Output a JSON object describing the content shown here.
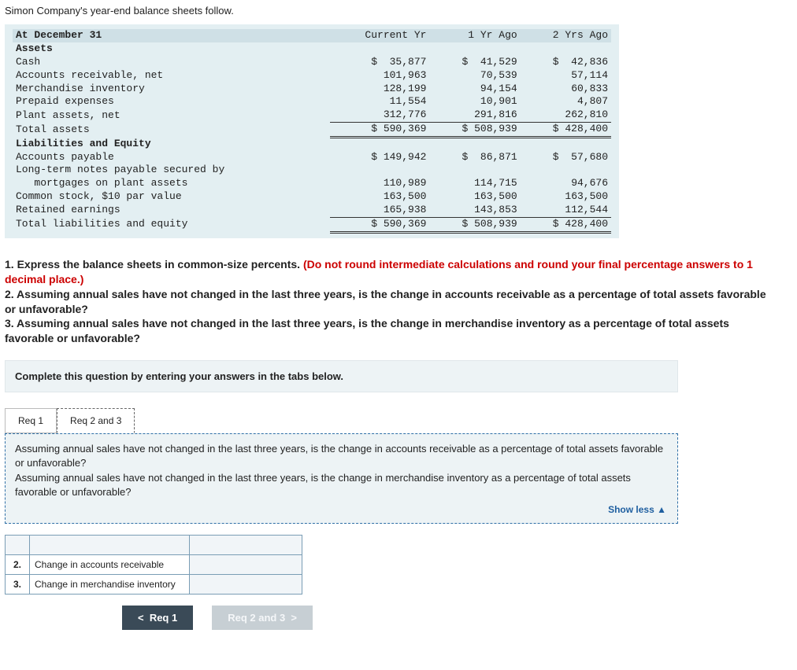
{
  "intro": "Simon Company's year-end balance sheets follow.",
  "bs": {
    "header": "At December 31",
    "cols": [
      "Current Yr",
      "1 Yr Ago",
      "2 Yrs Ago"
    ],
    "assets_hdr": "Assets",
    "rows_assets": [
      {
        "label": "Cash",
        "c": "$  35,877",
        "y1": "$  41,529",
        "y2": "$  42,836"
      },
      {
        "label": "Accounts receivable, net",
        "c": "101,963",
        "y1": "70,539",
        "y2": "57,114"
      },
      {
        "label": "Merchandise inventory",
        "c": "128,199",
        "y1": "94,154",
        "y2": "60,833"
      },
      {
        "label": "Prepaid expenses",
        "c": "11,554",
        "y1": "10,901",
        "y2": "4,807"
      },
      {
        "label": "Plant assets, net",
        "c": "312,776",
        "y1": "291,816",
        "y2": "262,810",
        "under": true
      }
    ],
    "total_assets": {
      "label": "Total assets",
      "c": "$ 590,369",
      "y1": "$ 508,939",
      "y2": "$ 428,400"
    },
    "liabeq_hdr": "Liabilities and Equity",
    "rows_liab": [
      {
        "label": "Accounts payable",
        "c": "$ 149,942",
        "y1": "$  86,871",
        "y2": "$  57,680"
      },
      {
        "label": "Long-term notes payable secured by",
        "c": "",
        "y1": "",
        "y2": ""
      },
      {
        "label": "   mortgages on plant assets",
        "c": "110,989",
        "y1": "114,715",
        "y2": "94,676"
      },
      {
        "label": "Common stock, $10 par value",
        "c": "163,500",
        "y1": "163,500",
        "y2": "163,500"
      },
      {
        "label": "Retained earnings",
        "c": "165,938",
        "y1": "143,853",
        "y2": "112,544",
        "under": true
      }
    ],
    "total_liab": {
      "label": "Total liabilities and equity",
      "c": "$ 590,369",
      "y1": "$ 508,939",
      "y2": "$ 428,400"
    }
  },
  "q": {
    "q1a": "1. Express the balance sheets in common-size percents. ",
    "q1b": "(Do not round intermediate calculations and round your final percentage answers to 1 decimal place.)",
    "q2": "2. Assuming annual sales have not changed in the last three years, is the change in accounts receivable as a percentage of total assets favorable or unfavorable?",
    "q3": "3. Assuming annual sales have not changed in the last three years, is the change in merchandise inventory as a percentage of total assets favorable or unfavorable?"
  },
  "instr": "Complete this question by entering your answers in the tabs below.",
  "tabs": {
    "t1": "Req 1",
    "t2": "Req 2 and 3"
  },
  "tabtext": {
    "l1": "Assuming annual sales have not changed in the last three years, is the change in accounts receivable as a percentage of total assets favorable or unfavorable?",
    "l2": "Assuming annual sales have not changed in the last three years, is the change in merchandise inventory as a percentage of total assets favorable or unfavorable?",
    "showless": "Show less"
  },
  "grid": {
    "r2num": "2.",
    "r2label": "Change in accounts receivable",
    "r3num": "3.",
    "r3label": "Change in merchandise inventory"
  },
  "nav": {
    "prev": "Req 1",
    "next": "Req 2 and 3"
  }
}
